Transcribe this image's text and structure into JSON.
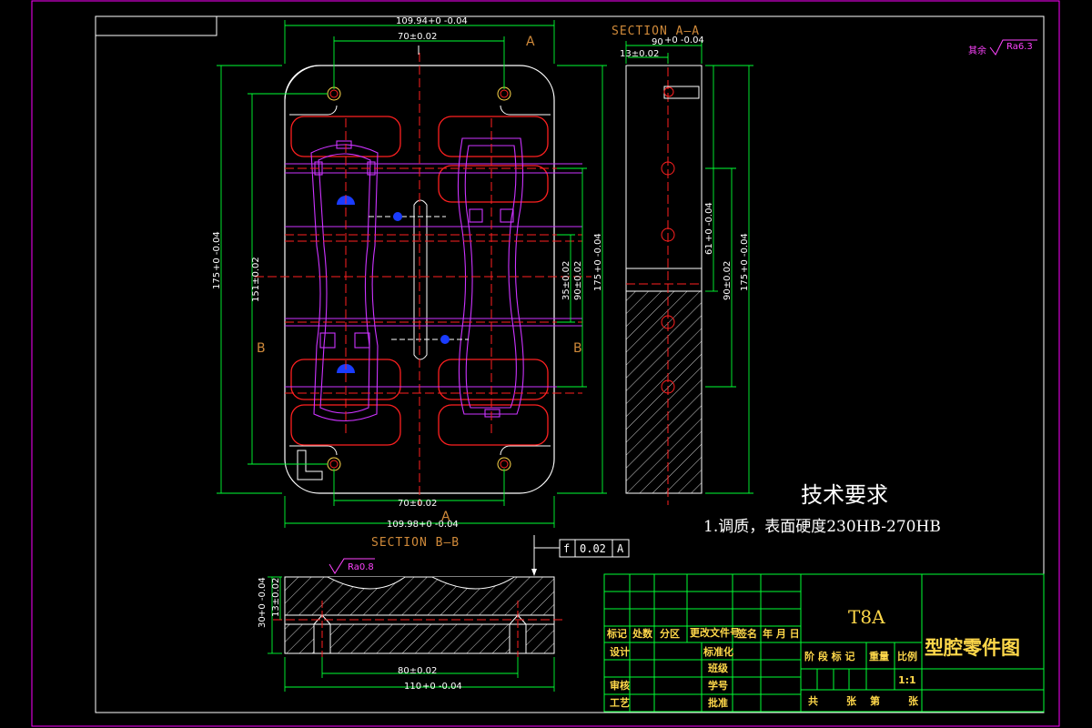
{
  "view_labels": {
    "a_top": "A",
    "a_bottom": "A",
    "b_left": "B",
    "b_right": "B",
    "section_aa": "SECTION A—A",
    "section_bb": "SECTION B—B"
  },
  "dimensions": {
    "top_width": "109.94",
    "top_width_tol": "+0 -0.04",
    "top_70": "70±0.02",
    "bottom_70": "70±0.02",
    "bottom_width": "109.98",
    "bottom_width_tol": "+0 -0.04",
    "left_175": "175",
    "left_175_tol": "+0 -0.04",
    "left_151": "151±0.02",
    "right_35": "35±0.02",
    "right_90": "90±0.02",
    "right_175": "175",
    "right_175_tol": "+0 -0.04",
    "aa_90": "90",
    "aa_90_tol": "+0 -0.04",
    "aa_13": "13±0.02",
    "aa_61": "61",
    "aa_61_tol": "+0 -0.04",
    "aa_90b": "90±0.02",
    "aa_175": "175",
    "aa_175_tol": "+0 -0.04",
    "bb_13": "13±0.02",
    "bb_30": "30",
    "bb_30_tol": "+0 -0.04",
    "bb_80": "80±0.02",
    "bb_110": "110",
    "bb_110_tol": "+0 -0.04"
  },
  "roughness": {
    "other": "其余",
    "other_value": "Ra6.3",
    "bb_value": "Ra0.8"
  },
  "flatness": {
    "symbol": "f",
    "value": "0.02",
    "datum": "A"
  },
  "tech_requirements": {
    "title": "技术要求",
    "line1": "1.调质，表面硬度230HB-270HB"
  },
  "title_block": {
    "material": "T8A",
    "drawing_name": "型腔零件图",
    "scale": "1:1",
    "cells": {
      "mark": "标记",
      "count": "处数",
      "zone": "分区",
      "change_doc": "更改文件号",
      "sign": "签名",
      "date": "年 月 日",
      "design": "设计",
      "standardize": "标准化",
      "review": "审核",
      "process": "工艺",
      "class": "班级",
      "student_no": "学号",
      "approve": "批准",
      "stage_mark": "阶 段 标 记",
      "weight": "重量",
      "ratio": "比例",
      "total": "共",
      "sheets": "张",
      "sheet_no": "第",
      "sheet_unit": "张"
    }
  },
  "colors": {
    "frame": "#ff00ff",
    "outline": "#ffffff",
    "dimension": "#00ff33",
    "cavity": "#ff2020",
    "part": "#cc33ff",
    "center": "#ff2020",
    "gate": "#1a3cff",
    "title_text": "#ffd84a",
    "label": "#d08a3a"
  }
}
